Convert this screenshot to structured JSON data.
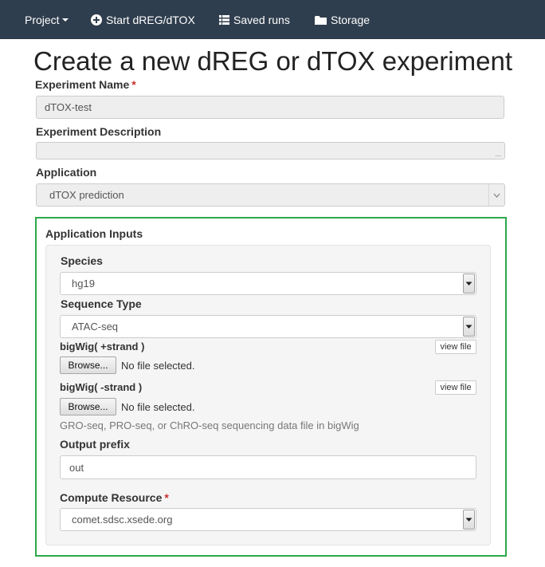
{
  "nav": {
    "project": "Project",
    "start": "Start dREG/dTOX",
    "saved_runs": "Saved runs",
    "storage": "Storage"
  },
  "page_title": "Create a new dREG or dTOX experiment",
  "experiment_name": {
    "label": "Experiment Name",
    "required_mark": "*",
    "value": "dTOX-test"
  },
  "experiment_description": {
    "label": "Experiment Description",
    "value": "",
    "grip": "..."
  },
  "application": {
    "label": "Application",
    "selected": "dTOX prediction"
  },
  "inputs": {
    "title": "Application Inputs",
    "species": {
      "label": "Species",
      "selected": "hg19"
    },
    "sequence_type": {
      "label": "Sequence Type",
      "selected": "ATAC-seq"
    },
    "bigwig_plus": {
      "label": "bigWig( +strand )",
      "view_file": "view file",
      "browse": "Browse...",
      "status": "No file selected."
    },
    "bigwig_minus": {
      "label": "bigWig( -strand )",
      "view_file": "view file",
      "browse": "Browse...",
      "status": "No file selected."
    },
    "help_text": "GRO-seq, PRO-seq, or ChRO-seq sequencing data file in bigWig",
    "output_prefix": {
      "label": "Output prefix",
      "value": "out"
    },
    "compute_resource": {
      "label": "Compute Resource",
      "required_mark": "*",
      "selected": "comet.sdsc.xsede.org"
    }
  },
  "colors": {
    "navbar": "#2f3e4e",
    "highlight_border": "#2ea84a",
    "required": "#c9302c"
  },
  "icons": {
    "start": "plus-circle-icon",
    "saved_runs": "list-icon",
    "storage": "folder-icon"
  }
}
